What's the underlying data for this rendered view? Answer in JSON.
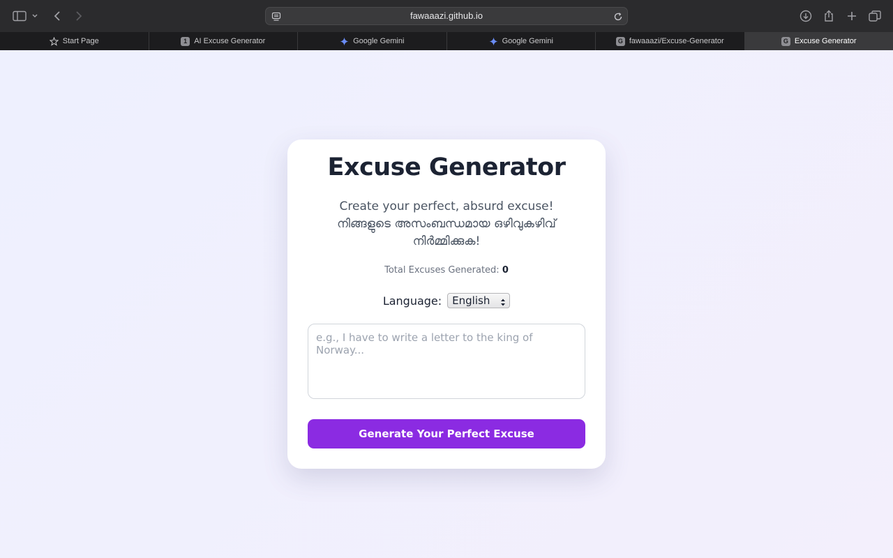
{
  "browser": {
    "url": "fawaaazi.github.io",
    "tabs": [
      {
        "label": "Start Page",
        "icon": "star-icon",
        "active": false
      },
      {
        "label": "AI Excuse Generator",
        "icon": "favicon-1",
        "badge": "1",
        "active": false
      },
      {
        "label": "Google Gemini",
        "icon": "gemini-icon",
        "active": false
      },
      {
        "label": "Google Gemini",
        "icon": "gemini-icon",
        "active": false
      },
      {
        "label": "fawaaazi/Excuse-Generator",
        "icon": "favicon-g",
        "badge": "G",
        "active": false
      },
      {
        "label": "Excuse Generator",
        "icon": "favicon-g",
        "badge": "G",
        "active": true
      }
    ]
  },
  "app": {
    "title": "Excuse Generator",
    "subtitle_en": "Create your perfect, absurd excuse!",
    "subtitle_ml": "നിങ്ങളുടെ അസംബന്ധമായ ഒഴിവുകഴിവ് നിർമ്മിക്കുക!",
    "counter_label": "Total Excuses Generated:",
    "counter_value": "0",
    "language_label": "Language:",
    "language_selected": "English",
    "input_placeholder": "e.g., I have to write a letter to the king of Norway...",
    "generate_label": "Generate Your Perfect Excuse",
    "accent_color": "#8b2be2"
  }
}
